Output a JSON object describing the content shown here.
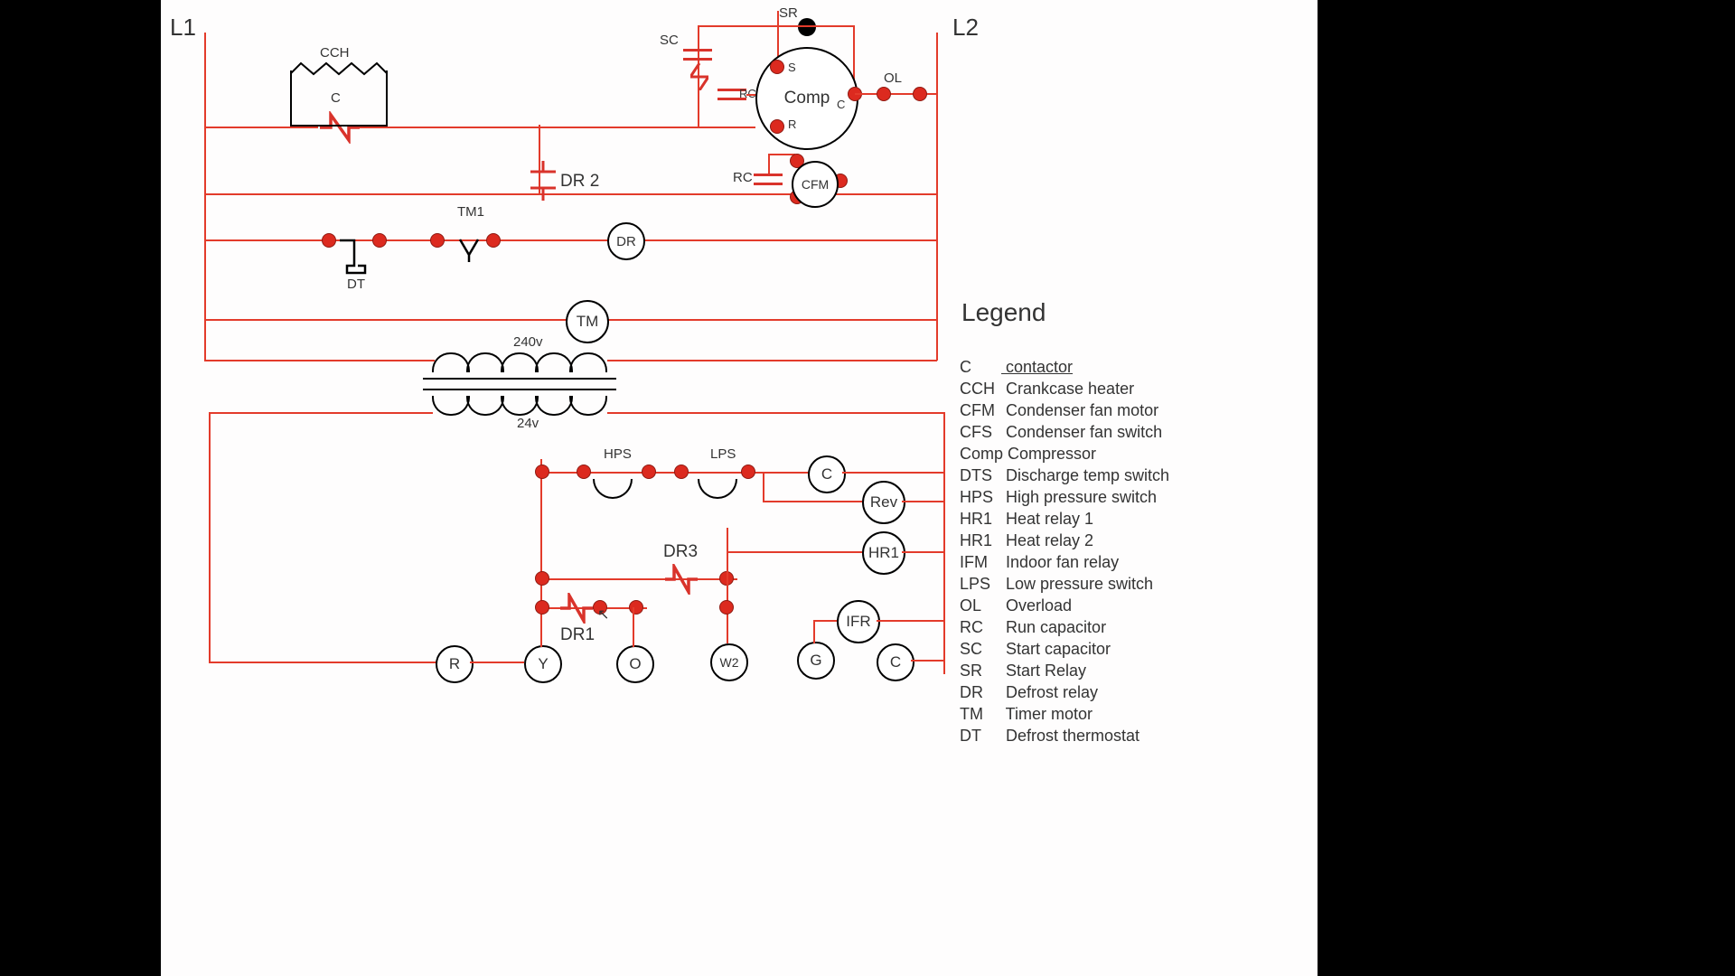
{
  "labels": {
    "L1": "L1",
    "L2": "L2",
    "CCH": "CCH",
    "C": "C",
    "SC": "SC",
    "SR": "SR",
    "Comp": "Comp",
    "S": "S",
    "Cc": "C",
    "R": "R",
    "RC": "RC",
    "OL": "OL",
    "RC2": "RC",
    "CFM": "CFM",
    "DR2": "DR 2",
    "TM1": "TM1",
    "DT": "DT",
    "DR": "DR",
    "TM": "TM",
    "v240": "240v",
    "v24": "24v",
    "HPS": "HPS",
    "LPS": "LPS",
    "Ccirc": "C",
    "Rev": "Rev",
    "HR1": "HR1",
    "DR3": "DR3",
    "DR1": "DR1",
    "IFR": "IFR",
    "termR": "R",
    "termY": "Y",
    "termO": "O",
    "termW2": "W2",
    "termG": "G",
    "termC": "C"
  },
  "legend": {
    "title": "Legend",
    "items": [
      {
        "abbr": "C",
        "desc": "contactor",
        "u": true
      },
      {
        "abbr": "CCH",
        "desc": "Crankcase heater"
      },
      {
        "abbr": "CFM",
        "desc": "Condenser fan motor"
      },
      {
        "abbr": "CFS",
        "desc": "Condenser fan switch"
      },
      {
        "abbr": "Comp",
        "desc": "Compressor"
      },
      {
        "abbr": "DTS",
        "desc": "Discharge temp switch"
      },
      {
        "abbr": "HPS",
        "desc": "High pressure switch"
      },
      {
        "abbr": "HR1",
        "desc": "Heat relay 1"
      },
      {
        "abbr": "HR1",
        "desc": "Heat relay 2"
      },
      {
        "abbr": "IFM",
        "desc": "Indoor fan relay"
      },
      {
        "abbr": "LPS",
        "desc": "Low pressure switch"
      },
      {
        "abbr": "OL",
        "desc": "Overload"
      },
      {
        "abbr": "RC",
        "desc": "Run capacitor"
      },
      {
        "abbr": "SC",
        "desc": "Start capacitor"
      },
      {
        "abbr": "SR",
        "desc": "Start Relay"
      },
      {
        "abbr": "DR",
        "desc": "Defrost relay"
      },
      {
        "abbr": "TM",
        "desc": "Timer motor"
      },
      {
        "abbr": "DT",
        "desc": "Defrost thermostat"
      }
    ]
  }
}
